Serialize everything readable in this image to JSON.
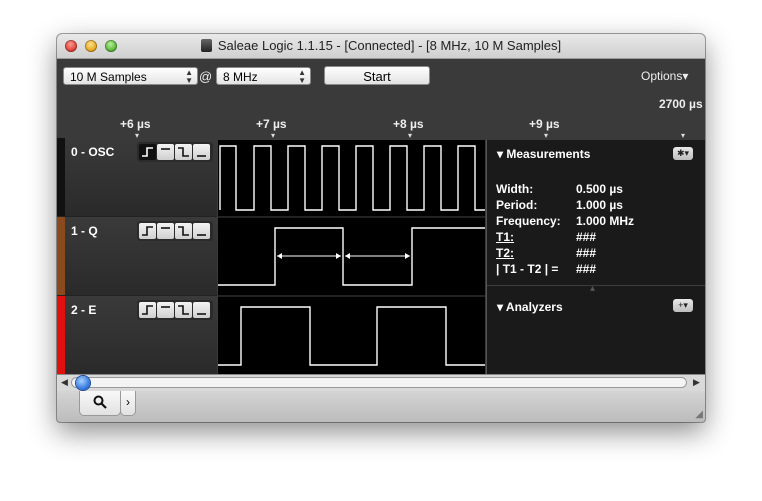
{
  "window": {
    "title": "Saleae Logic 1.1.15 - [Connected] - [8 MHz, 10 M Samples]"
  },
  "toolbar": {
    "samples_value": "10 M Samples",
    "at_symbol": "@",
    "rate_value": "8 MHz",
    "start_label": "Start",
    "options_label": "Options▾"
  },
  "timeline": {
    "ticks": [
      "+6 µs",
      "+7 µs",
      "+8 µs",
      "+9 µs"
    ],
    "absolute": "2700 µs"
  },
  "channels": [
    {
      "label": "0 - OSC",
      "color": "#111111"
    },
    {
      "label": "1 - Q",
      "color": "#8a4a1e"
    },
    {
      "label": "2 - E",
      "color": "#e01010"
    }
  ],
  "measurements": {
    "header": "Measurements",
    "rows": [
      {
        "label": "Width:",
        "value": "0.500 µs"
      },
      {
        "label": "Period:",
        "value": "1.000 µs"
      },
      {
        "label": "Frequency:",
        "value": "1.000 MHz"
      },
      {
        "label": "T1:",
        "value": "###"
      },
      {
        "label": "T2:",
        "value": "###"
      },
      {
        "label": "| T1 - T2 | =",
        "value": "###"
      }
    ],
    "settings_icon": "gear-icon"
  },
  "analyzers": {
    "header": "Analyzers",
    "add_icon": "plus-icon"
  },
  "bottom_tabs": {
    "search_icon": "magnifier-icon",
    "next_icon": "chevron-right-icon"
  }
}
